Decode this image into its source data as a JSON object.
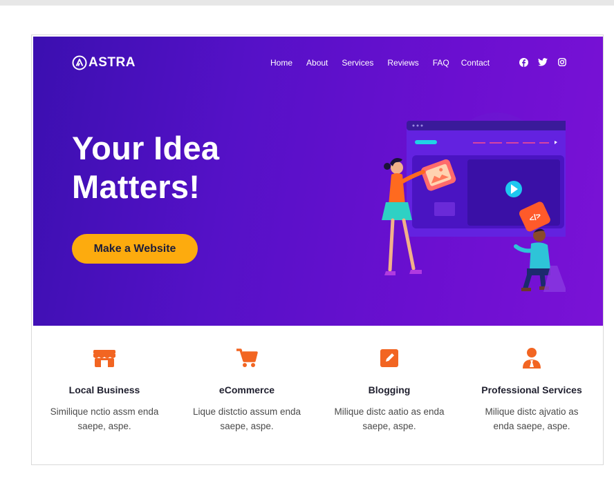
{
  "brand": {
    "name": "ASTRA"
  },
  "nav": {
    "items": [
      "Home",
      "About",
      "Services",
      "Reviews",
      "FAQ",
      "Contact"
    ]
  },
  "social": {
    "icons": [
      "facebook-icon",
      "twitter-icon",
      "instagram-icon"
    ]
  },
  "hero": {
    "headline_line1": "Your Idea",
    "headline_line2": "Matters!",
    "cta_label": "Make a Website"
  },
  "features": [
    {
      "icon": "store-icon",
      "title": "Local Business",
      "text": "Similique nctio assm enda saepe, aspe."
    },
    {
      "icon": "cart-icon",
      "title": "eCommerce",
      "text": "Lique distctio assum enda saepe, aspe."
    },
    {
      "icon": "edit-icon",
      "title": "Blogging",
      "text": "Milique distc aatio as enda saepe, aspe."
    },
    {
      "icon": "professional-icon",
      "title": "Professional Services",
      "text": "Milique distc ajvatio as enda saepe, aspe."
    }
  ],
  "colors": {
    "hero_start": "#3b0fb0",
    "hero_end": "#7a12d6",
    "cta": "#fdab0e",
    "feature_icon": "#f26522"
  }
}
